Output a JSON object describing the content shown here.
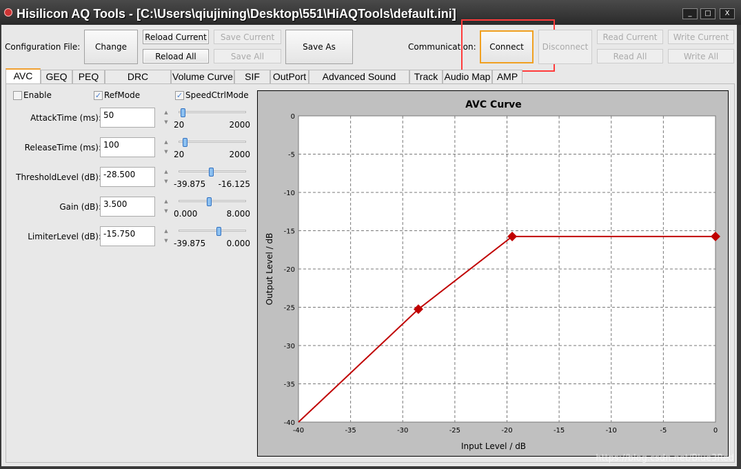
{
  "window": {
    "title": "Hisilicon AQ Tools - [C:\\Users\\qiujining\\Desktop\\551\\HiAQTools\\default.ini]",
    "minimize": "_",
    "maximize": "□",
    "close": "X"
  },
  "toolbar": {
    "config_label": "Configuration File:",
    "change": "Change",
    "reload_current": "Reload Current",
    "reload_all": "Reload All",
    "save_current": "Save Current",
    "save_all": "Save All",
    "save_as": "Save As",
    "comm_label": "Communication:",
    "connect": "Connect",
    "disconnect": "Disconnect",
    "read_current": "Read Current",
    "read_all": "Read All",
    "write_current": "Write Current",
    "write_all": "Write All",
    "highlight_color": "#ff3b3b"
  },
  "tabs": [
    "AVC",
    "GEQ",
    "PEQ",
    "DRC (Speaker)",
    "Volume Curve",
    "SIF",
    "OutPort",
    "Advanced Sound Effect",
    "Track",
    "Audio Map",
    "AMP"
  ],
  "active_tab": "AVC",
  "checkboxes": [
    {
      "label": "Enable",
      "checked": false
    },
    {
      "label": "RefMode",
      "checked": true
    },
    {
      "label": "SpeedCtrlMode",
      "checked": true
    }
  ],
  "params": [
    {
      "label": "AttackTime (ms):",
      "value": "50",
      "min": "20",
      "max": "2000",
      "fraction": 0.02
    },
    {
      "label": "ReleaseTime (ms):",
      "value": "100",
      "min": "20",
      "max": "2000",
      "fraction": 0.06
    },
    {
      "label": "ThresholdLevel (dB):",
      "value": "-28.500",
      "min": "-39.875",
      "max": "-16.125",
      "fraction": 0.48
    },
    {
      "label": "Gain (dB):",
      "value": "3.500",
      "min": "0.000",
      "max": "8.000",
      "fraction": 0.44
    },
    {
      "label": "LimiterLevel (dB):",
      "value": "-15.750",
      "min": "-39.875",
      "max": "0.000",
      "fraction": 0.6
    }
  ],
  "chart_data": {
    "type": "line",
    "title": "AVC Curve",
    "xlabel": "Input Level / dB",
    "ylabel": "Output Level / dB",
    "xlim": [
      -40,
      0
    ],
    "ylim": [
      -40,
      0
    ],
    "xticks": [
      "-40",
      "-35",
      "-30",
      "-25",
      "-20",
      "-15",
      "-10",
      "-5",
      "0"
    ],
    "yticks": [
      "0",
      "-5",
      "-10",
      "-15",
      "-20",
      "-25",
      "-30",
      "-35",
      "-40"
    ],
    "grid": true,
    "color": "#c00000",
    "points": [
      [
        -40,
        -40
      ],
      [
        -28.5,
        -25.25
      ],
      [
        -19.5,
        -15.75
      ],
      [
        0,
        -15.75
      ]
    ],
    "markers": [
      [
        -28.5,
        -25.25
      ],
      [
        -19.5,
        -15.75
      ],
      [
        0,
        -15.75
      ]
    ]
  },
  "watermark": "https://blog.csdn.net/Blue3Red"
}
